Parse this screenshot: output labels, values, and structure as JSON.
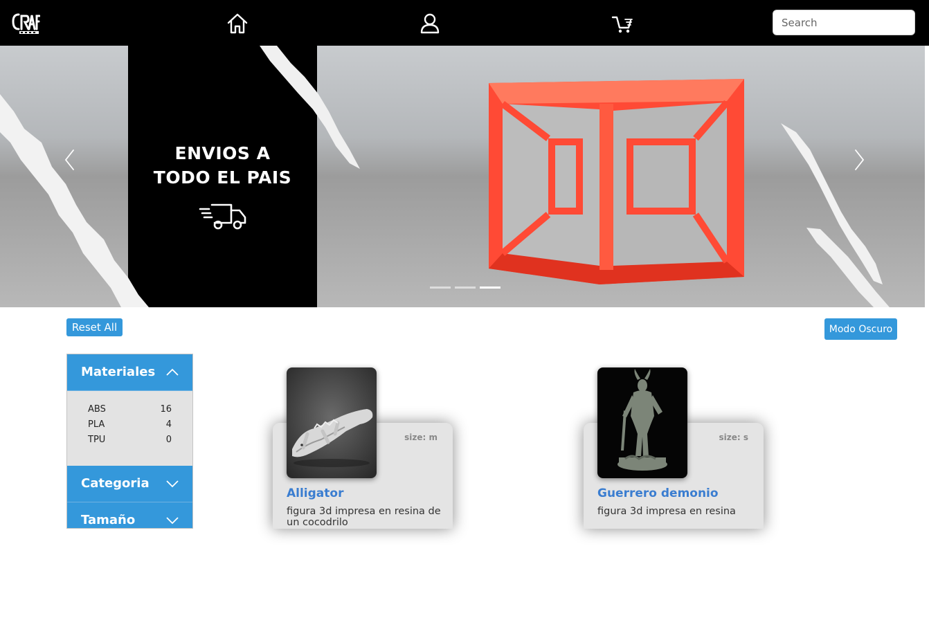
{
  "navbar": {
    "logo_text": "CRAFT",
    "icons": [
      "home-icon",
      "user-icon",
      "cart-icon"
    ],
    "search_placeholder": "Search",
    "background": "#000000"
  },
  "hero": {
    "promo_text": "ENVIOS A\nTODO EL PAIS",
    "slides": 3,
    "active_slide": 3
  },
  "controls": {
    "reset_label": "Reset All",
    "dark_mode_label": "Modo Oscuro",
    "accent_color": "#3498db"
  },
  "filters": {
    "materials": {
      "title": "Materiales",
      "items": [
        {
          "name": "ABS",
          "count": "16"
        },
        {
          "name": "PLA",
          "count": "4"
        },
        {
          "name": "TPU",
          "count": "0"
        }
      ]
    },
    "category": {
      "title": "Categoria"
    },
    "size": {
      "title": "Tamaño"
    }
  },
  "products": [
    {
      "name": "Alligator",
      "size": "size: m",
      "description": "figura 3d impresa en resina de un cocodrilo"
    },
    {
      "name": "Guerrero demonio",
      "size": "size: s",
      "description": "figura 3d impresa en resina"
    }
  ]
}
